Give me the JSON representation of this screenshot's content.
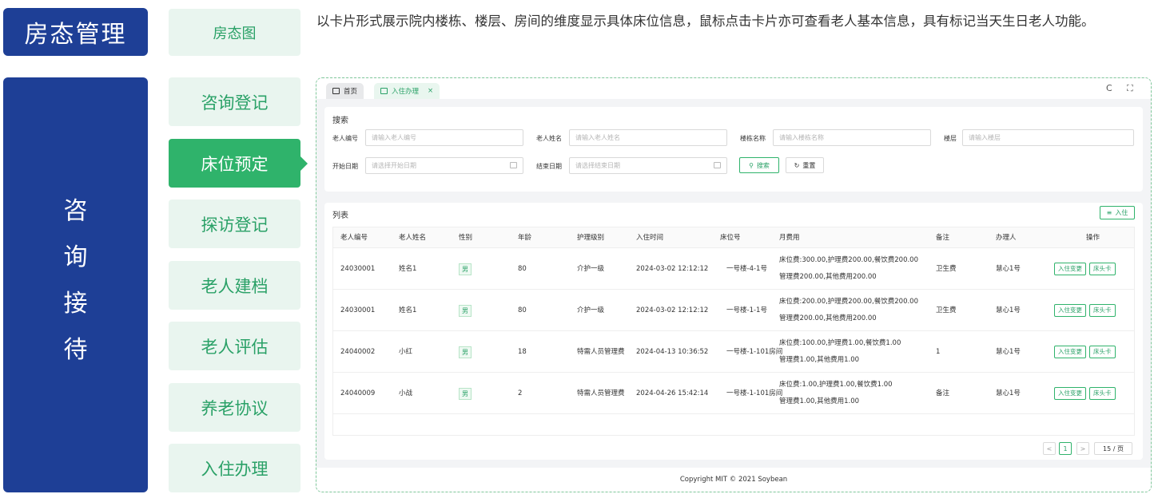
{
  "categories": {
    "top": "房态管理",
    "side": [
      "咨",
      "询",
      "接",
      "待"
    ]
  },
  "menu": [
    {
      "label": "房态图"
    },
    {
      "label": "咨询登记"
    },
    {
      "label": "床位预定"
    },
    {
      "label": "探访登记"
    },
    {
      "label": "老人建档"
    },
    {
      "label": "老人评估"
    },
    {
      "label": "养老协议"
    },
    {
      "label": "入住办理"
    }
  ],
  "description": "以卡片形式展示院内楼栋、楼层、房间的维度显示具体床位信息，鼠标点击卡片亦可查看老人基本信息，具有标记当天生日老人功能。",
  "app": {
    "tabs": [
      {
        "label": "首页"
      },
      {
        "label": "入住办理",
        "close": "×"
      }
    ],
    "refresh_icon": "C",
    "fullscreen_icon": "⛶",
    "search": {
      "title": "搜索",
      "fields": [
        {
          "label": "老人编号",
          "placeholder": "请输入老人编号"
        },
        {
          "label": "老人姓名",
          "placeholder": "请输入老人姓名"
        },
        {
          "label": "楼栋名称",
          "placeholder": "请输入楼栋名称"
        },
        {
          "label": "楼层",
          "placeholder": "请输入楼层"
        },
        {
          "label": "开始日期",
          "placeholder": "请选择开始日期"
        },
        {
          "label": "结束日期",
          "placeholder": "请选择结束日期"
        }
      ],
      "search_button": "搜索",
      "reset_button": "重置"
    },
    "list": {
      "title": "列表",
      "add_button": "入住",
      "columns": [
        "老人编号",
        "老人姓名",
        "性别",
        "年龄",
        "护理级别",
        "入住时间",
        "床位号",
        "月费用",
        "备注",
        "办理人",
        "操作"
      ],
      "rows": [
        {
          "id": "24030001",
          "name": "姓名1",
          "gender": "男",
          "age": "80",
          "care": "介护一级",
          "time": "2024-03-02 12:12:12",
          "bed": "一号楼-4-1号",
          "fee1": "床位费:300.00,护理费200.00,餐饮费200.00",
          "fee2": "管理费200.00,其他费用200.00",
          "note": "卫生费",
          "handler": "慧心1号"
        },
        {
          "id": "24030001",
          "name": "姓名1",
          "gender": "男",
          "age": "80",
          "care": "介护一级",
          "time": "2024-03-02 12:12:12",
          "bed": "一号楼-1-1号",
          "fee1": "床位费:200.00,护理费200.00,餐饮费200.00",
          "fee2": "管理费200.00,其他费用200.00",
          "note": "卫生费",
          "handler": "慧心1号"
        },
        {
          "id": "24040002",
          "name": "小红",
          "gender": "男",
          "age": "18",
          "care": "特需人员管理费",
          "time": "2024-04-13 10:36:52",
          "bed": "一号楼-1-101房间",
          "fee1": "床位费:100.00,护理费1.00,餐饮费1.00",
          "fee2": "管理费1.00,其他费用1.00",
          "note": "1",
          "handler": "慧心1号"
        },
        {
          "id": "24040009",
          "name": "小战",
          "gender": "男",
          "age": "2",
          "care": "特需人员管理费",
          "time": "2024-04-26 15:42:14",
          "bed": "一号楼-1-101房间",
          "fee1": "床位费:1.00,护理费1.00,餐饮费1.00",
          "fee2": "管理费1.00,其他费用1.00",
          "note": "备注",
          "handler": "慧心1号"
        }
      ],
      "actions": [
        "入住变更",
        "床头卡"
      ]
    },
    "pagination": {
      "prev": "<",
      "page": "1",
      "next": ">",
      "size": "15 / 页"
    },
    "footer": "Copyright MIT © 2021 Soybean"
  },
  "colors": {
    "navy": "#1e3f96",
    "green": "#2fb36b",
    "light_green": "#e9f5ef"
  }
}
